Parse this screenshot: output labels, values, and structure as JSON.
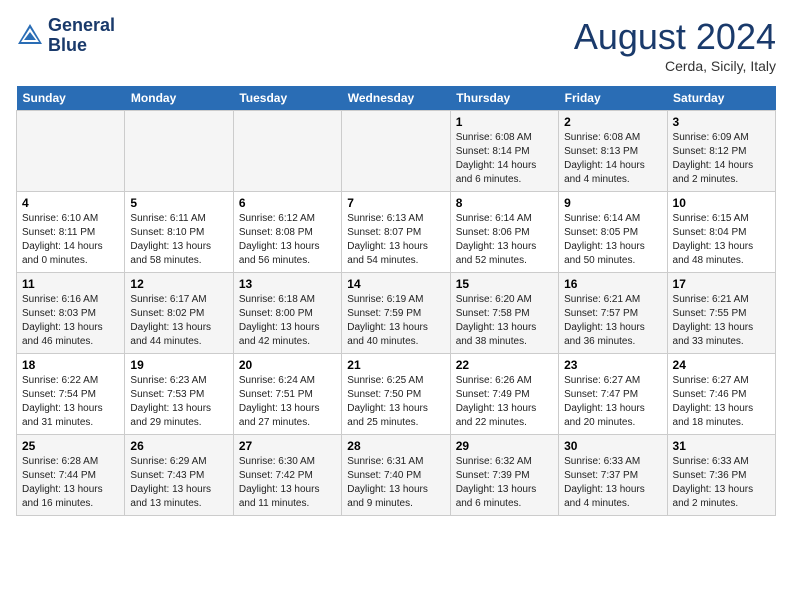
{
  "header": {
    "logo_line1": "General",
    "logo_line2": "Blue",
    "month": "August 2024",
    "location": "Cerda, Sicily, Italy"
  },
  "weekdays": [
    "Sunday",
    "Monday",
    "Tuesday",
    "Wednesday",
    "Thursday",
    "Friday",
    "Saturday"
  ],
  "weeks": [
    [
      {
        "day": "",
        "info": ""
      },
      {
        "day": "",
        "info": ""
      },
      {
        "day": "",
        "info": ""
      },
      {
        "day": "",
        "info": ""
      },
      {
        "day": "1",
        "info": "Sunrise: 6:08 AM\nSunset: 8:14 PM\nDaylight: 14 hours\nand 6 minutes."
      },
      {
        "day": "2",
        "info": "Sunrise: 6:08 AM\nSunset: 8:13 PM\nDaylight: 14 hours\nand 4 minutes."
      },
      {
        "day": "3",
        "info": "Sunrise: 6:09 AM\nSunset: 8:12 PM\nDaylight: 14 hours\nand 2 minutes."
      }
    ],
    [
      {
        "day": "4",
        "info": "Sunrise: 6:10 AM\nSunset: 8:11 PM\nDaylight: 14 hours\nand 0 minutes."
      },
      {
        "day": "5",
        "info": "Sunrise: 6:11 AM\nSunset: 8:10 PM\nDaylight: 13 hours\nand 58 minutes."
      },
      {
        "day": "6",
        "info": "Sunrise: 6:12 AM\nSunset: 8:08 PM\nDaylight: 13 hours\nand 56 minutes."
      },
      {
        "day": "7",
        "info": "Sunrise: 6:13 AM\nSunset: 8:07 PM\nDaylight: 13 hours\nand 54 minutes."
      },
      {
        "day": "8",
        "info": "Sunrise: 6:14 AM\nSunset: 8:06 PM\nDaylight: 13 hours\nand 52 minutes."
      },
      {
        "day": "9",
        "info": "Sunrise: 6:14 AM\nSunset: 8:05 PM\nDaylight: 13 hours\nand 50 minutes."
      },
      {
        "day": "10",
        "info": "Sunrise: 6:15 AM\nSunset: 8:04 PM\nDaylight: 13 hours\nand 48 minutes."
      }
    ],
    [
      {
        "day": "11",
        "info": "Sunrise: 6:16 AM\nSunset: 8:03 PM\nDaylight: 13 hours\nand 46 minutes."
      },
      {
        "day": "12",
        "info": "Sunrise: 6:17 AM\nSunset: 8:02 PM\nDaylight: 13 hours\nand 44 minutes."
      },
      {
        "day": "13",
        "info": "Sunrise: 6:18 AM\nSunset: 8:00 PM\nDaylight: 13 hours\nand 42 minutes."
      },
      {
        "day": "14",
        "info": "Sunrise: 6:19 AM\nSunset: 7:59 PM\nDaylight: 13 hours\nand 40 minutes."
      },
      {
        "day": "15",
        "info": "Sunrise: 6:20 AM\nSunset: 7:58 PM\nDaylight: 13 hours\nand 38 minutes."
      },
      {
        "day": "16",
        "info": "Sunrise: 6:21 AM\nSunset: 7:57 PM\nDaylight: 13 hours\nand 36 minutes."
      },
      {
        "day": "17",
        "info": "Sunrise: 6:21 AM\nSunset: 7:55 PM\nDaylight: 13 hours\nand 33 minutes."
      }
    ],
    [
      {
        "day": "18",
        "info": "Sunrise: 6:22 AM\nSunset: 7:54 PM\nDaylight: 13 hours\nand 31 minutes."
      },
      {
        "day": "19",
        "info": "Sunrise: 6:23 AM\nSunset: 7:53 PM\nDaylight: 13 hours\nand 29 minutes."
      },
      {
        "day": "20",
        "info": "Sunrise: 6:24 AM\nSunset: 7:51 PM\nDaylight: 13 hours\nand 27 minutes."
      },
      {
        "day": "21",
        "info": "Sunrise: 6:25 AM\nSunset: 7:50 PM\nDaylight: 13 hours\nand 25 minutes."
      },
      {
        "day": "22",
        "info": "Sunrise: 6:26 AM\nSunset: 7:49 PM\nDaylight: 13 hours\nand 22 minutes."
      },
      {
        "day": "23",
        "info": "Sunrise: 6:27 AM\nSunset: 7:47 PM\nDaylight: 13 hours\nand 20 minutes."
      },
      {
        "day": "24",
        "info": "Sunrise: 6:27 AM\nSunset: 7:46 PM\nDaylight: 13 hours\nand 18 minutes."
      }
    ],
    [
      {
        "day": "25",
        "info": "Sunrise: 6:28 AM\nSunset: 7:44 PM\nDaylight: 13 hours\nand 16 minutes."
      },
      {
        "day": "26",
        "info": "Sunrise: 6:29 AM\nSunset: 7:43 PM\nDaylight: 13 hours\nand 13 minutes."
      },
      {
        "day": "27",
        "info": "Sunrise: 6:30 AM\nSunset: 7:42 PM\nDaylight: 13 hours\nand 11 minutes."
      },
      {
        "day": "28",
        "info": "Sunrise: 6:31 AM\nSunset: 7:40 PM\nDaylight: 13 hours\nand 9 minutes."
      },
      {
        "day": "29",
        "info": "Sunrise: 6:32 AM\nSunset: 7:39 PM\nDaylight: 13 hours\nand 6 minutes."
      },
      {
        "day": "30",
        "info": "Sunrise: 6:33 AM\nSunset: 7:37 PM\nDaylight: 13 hours\nand 4 minutes."
      },
      {
        "day": "31",
        "info": "Sunrise: 6:33 AM\nSunset: 7:36 PM\nDaylight: 13 hours\nand 2 minutes."
      }
    ]
  ]
}
